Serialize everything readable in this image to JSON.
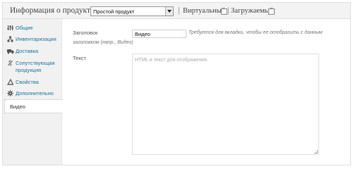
{
  "header": {
    "title": "Информация о продукте —",
    "product_type": "Простой продукт",
    "virtual_label": "Виртуальный:",
    "downloadable_label": "Загружаемый:"
  },
  "sidebar": {
    "items": [
      {
        "label": "Общие",
        "icon": "general-settings-icon"
      },
      {
        "label": "Инвентаризация",
        "icon": "inventory-icon"
      },
      {
        "label": "Доставка",
        "icon": "shipping-truck-icon"
      },
      {
        "label_line1": "Сопутствующая",
        "label_line2": "продукция",
        "icon": "linked-products-icon"
      },
      {
        "label": "Свойства",
        "icon": "attributes-icon"
      },
      {
        "label": "Дополнительно",
        "icon": "advanced-gear-icon"
      },
      {
        "label": "Видео",
        "active": true
      }
    ]
  },
  "form": {
    "title_label": "Заголовок",
    "title_value": "Видео",
    "title_hint_line1": "Требуется для вкладки, чтобы ее отобразить с данным",
    "title_hint_line2": "заголовком (напр., Видео)",
    "text_label": "Текст",
    "text_placeholder": "HTML и текст для отображения."
  },
  "colors": {
    "link": "#21759b",
    "sidebar_bg": "#f1f1f1",
    "header_bg": "#f3f3f3"
  }
}
